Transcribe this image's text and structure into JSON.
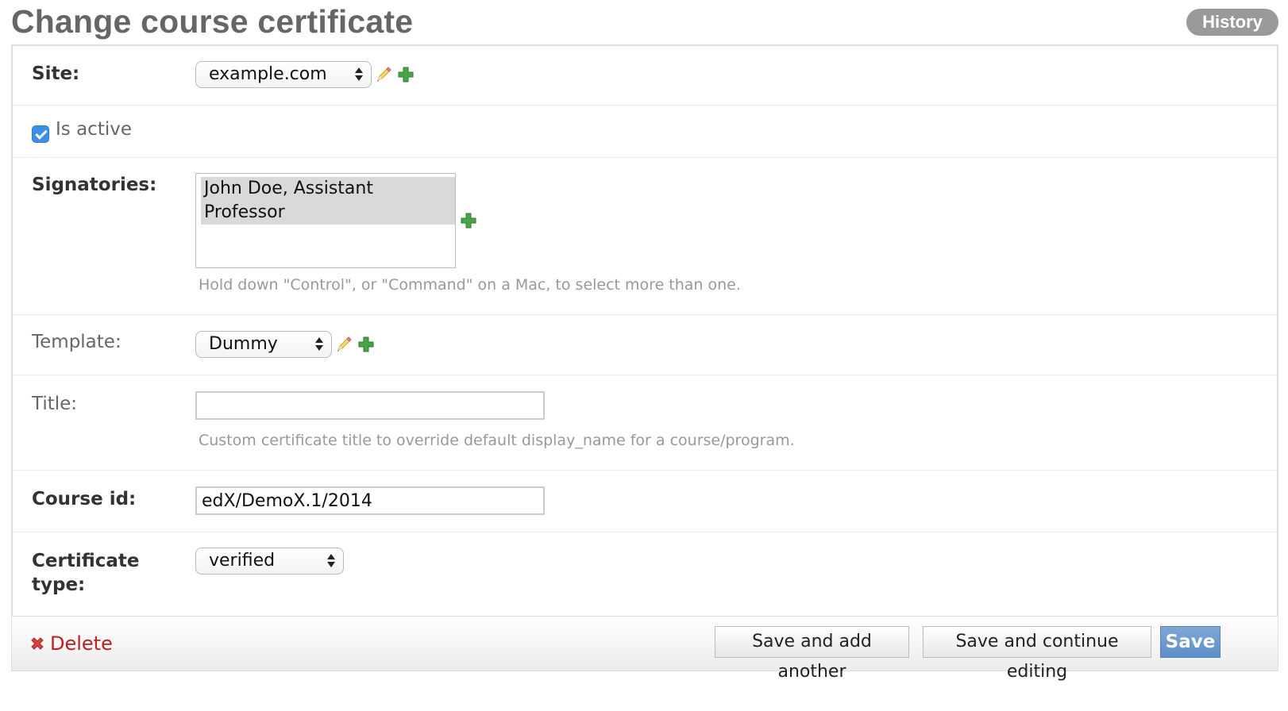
{
  "page": {
    "title": "Change course certificate",
    "history_label": "History"
  },
  "form": {
    "site": {
      "label": "Site:",
      "value": "example.com"
    },
    "is_active": {
      "label": "Is active",
      "checked": true
    },
    "signatories": {
      "label": "Signatories:",
      "options": [
        "John Doe, Assistant Professor"
      ],
      "help": "Hold down \"Control\", or \"Command\" on a Mac, to select more than one."
    },
    "template": {
      "label": "Template:",
      "value": "Dummy"
    },
    "title": {
      "label": "Title:",
      "value": "",
      "help": "Custom certificate title to override default display_name for a course/program."
    },
    "course_id": {
      "label": "Course id:",
      "value": "edX/DemoX.1/2014"
    },
    "certificate_type": {
      "label_line1": "Certificate",
      "label_line2": "type:",
      "value": "verified"
    }
  },
  "submit": {
    "delete_label": "Delete",
    "save_add_another": "Save and add another",
    "save_continue": "Save and continue editing",
    "save": "Save"
  },
  "icons": {
    "edit": "pencil-icon",
    "add": "plus-icon",
    "delete": "x-icon",
    "accent_green": "#3ba13b",
    "check_blue": "#3b8fe6",
    "delete_red": "#ba2121"
  }
}
